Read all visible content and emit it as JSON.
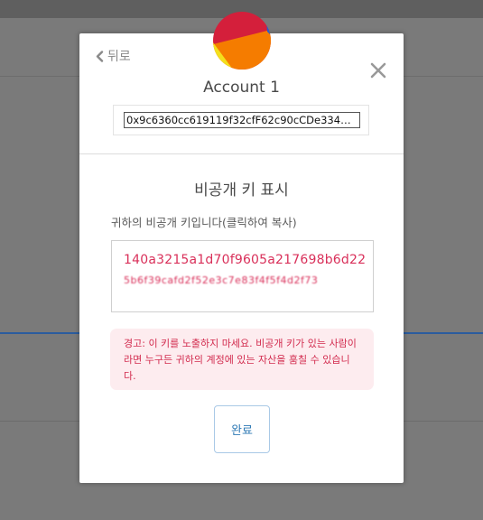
{
  "modal": {
    "back_label": "뒤로",
    "account_name": "Account 1",
    "address": "0x9c6360cc619119f32cfF62c90cCDe334…",
    "section_title": "비공개 키 표시",
    "instruction": "귀하의 비공개 키입니다(클릭하여 복사)",
    "private_key_line1": "140a3215a1d70f9605a217698b6d22",
    "private_key_line2": "5b6f39cafd2f52e3c7e83f4f5f4d2f73",
    "warning": "경고: 이 키를 노출하지 마세요. 비공개 키가 있는 사람이라면 누구든 귀하의 계정에 있는 자산을 훔칠 수 있습니다.",
    "done_label": "완료"
  },
  "icons": {
    "back": "chevron-left-icon",
    "close": "close-icon",
    "avatar": "identicon"
  },
  "colors": {
    "key_text": "#d9305a",
    "warning_bg": "#fdecef",
    "warning_text": "#d22b4e",
    "button_text": "#2f7ab5",
    "avatar_red": "#d41f3b",
    "avatar_orange": "#f57c00",
    "avatar_yellow": "#f3e01c",
    "avatar_blue": "#1f5fd6"
  }
}
